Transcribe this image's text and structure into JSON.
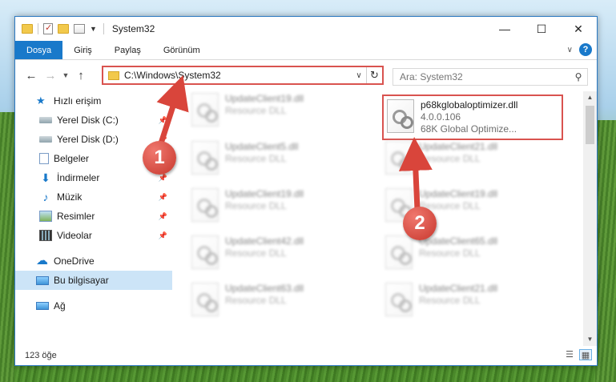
{
  "window": {
    "title": "System32",
    "controls": {
      "minimize": "—",
      "maximize": "☐",
      "close": "✕"
    }
  },
  "ribbon": {
    "tabs": [
      {
        "label": "Dosya",
        "active": true
      },
      {
        "label": "Giriş",
        "active": false
      },
      {
        "label": "Paylaş",
        "active": false
      },
      {
        "label": "Görünüm",
        "active": false
      }
    ]
  },
  "address": {
    "path": "C:\\Windows\\System32",
    "search_placeholder": "Ara: System32"
  },
  "sidebar": {
    "items": [
      {
        "label": "Hızlı erişim",
        "icon": "star-icon",
        "pinned": false
      },
      {
        "label": "Yerel Disk (C:)",
        "icon": "drive-icon",
        "pinned": true
      },
      {
        "label": "Yerel Disk (D:)",
        "icon": "drive-icon",
        "pinned": true
      },
      {
        "label": "Belgeler",
        "icon": "documents-icon",
        "pinned": true
      },
      {
        "label": "İndirmeler",
        "icon": "download-icon",
        "pinned": true
      },
      {
        "label": "Müzik",
        "icon": "music-icon",
        "pinned": true
      },
      {
        "label": "Resimler",
        "icon": "pictures-icon",
        "pinned": true
      },
      {
        "label": "Videolar",
        "icon": "video-icon",
        "pinned": true
      },
      {
        "label": "OneDrive",
        "icon": "cloud-icon",
        "pinned": false
      },
      {
        "label": "Bu bilgisayar",
        "icon": "computer-icon",
        "pinned": false,
        "selected": true
      },
      {
        "label": "Ağ",
        "icon": "network-icon",
        "pinned": false
      }
    ]
  },
  "files": {
    "highlighted": {
      "name": "p68kglobaloptimizer.dll",
      "version": "4.0.0.106",
      "description": "68K Global Optimize..."
    },
    "left_column": [
      {
        "name": "UpdateClient19.dll",
        "type": "Resource DLL"
      },
      {
        "name": "UpdateClient5.dll",
        "type": "Resource DLL"
      },
      {
        "name": "UpdateClient19.dll",
        "type": "Resource DLL"
      },
      {
        "name": "UpdateClient42.dll",
        "type": "Resource DLL"
      },
      {
        "name": "UpdateClient63.dll",
        "type": "Resource DLL"
      }
    ],
    "right_column": [
      {
        "name": "UpdateClient21.dll",
        "type": "Resource DLL"
      },
      {
        "name": "UpdateClient19.dll",
        "type": "Resource DLL"
      },
      {
        "name": "UpdateClient65.dll",
        "type": "Resource DLL"
      },
      {
        "name": "UpdateClient21.dll",
        "type": "Resource DLL"
      }
    ]
  },
  "status": {
    "count": "123 öğe"
  },
  "callouts": {
    "one": "1",
    "two": "2"
  },
  "colors": {
    "accent": "#1979ca",
    "highlight": "#d9534f",
    "selected": "#cce4f7"
  }
}
